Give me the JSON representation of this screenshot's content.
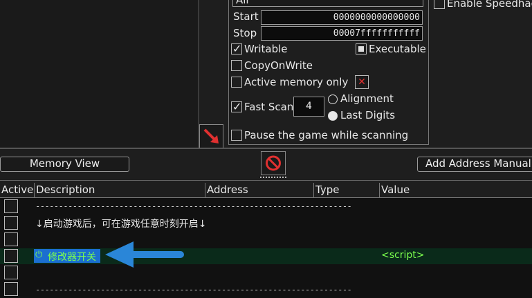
{
  "scan_panel": {
    "scan_type_value": "All",
    "start_label": "Start",
    "start_value": "0000000000000000",
    "stop_label": "Stop",
    "stop_value": "00007fffffffffff",
    "writable_label": "Writable",
    "executable_label": "Executable",
    "copyonwrite_label": "CopyOnWrite",
    "active_memory_label": "Active memory only",
    "fast_scan_label": "Fast Scan",
    "fast_scan_value": "4",
    "alignment_label": "Alignment",
    "last_digits_label": "Last Digits",
    "pause_label": "Pause the game while scanning"
  },
  "right_panel": {
    "enable_speedhack_label": "Enable Speedhac"
  },
  "toolbar": {
    "memory_view_label": "Memory View",
    "add_address_label": "Add Address Manuall"
  },
  "table": {
    "headers": [
      "Active",
      "Description",
      "Address",
      "Type",
      "Value"
    ],
    "rows": [
      {
        "description": "------------------------------------------------------------------------------------",
        "value": ""
      },
      {
        "description": "↓启动游戏后，可在游戏任意时刻开启↓",
        "value": ""
      },
      {
        "description": "",
        "value": ""
      },
      {
        "description": "修改器开关",
        "value": "<script>"
      },
      {
        "description": "",
        "value": ""
      },
      {
        "description": "------------------------------------------------------------------------------------",
        "value": ""
      }
    ]
  },
  "colors": {
    "selected_row_bg": "#0a2a1a",
    "selected_label_bg": "#1b6fd0",
    "script_green": "#7cff4e",
    "arrow_blue": "#2a86d8",
    "red_arrow": "#e03030"
  },
  "icons": [
    "red-arrow-icon",
    "no-entry-icon",
    "power-icon",
    "blue-arrow-icon",
    "close-icon"
  ]
}
